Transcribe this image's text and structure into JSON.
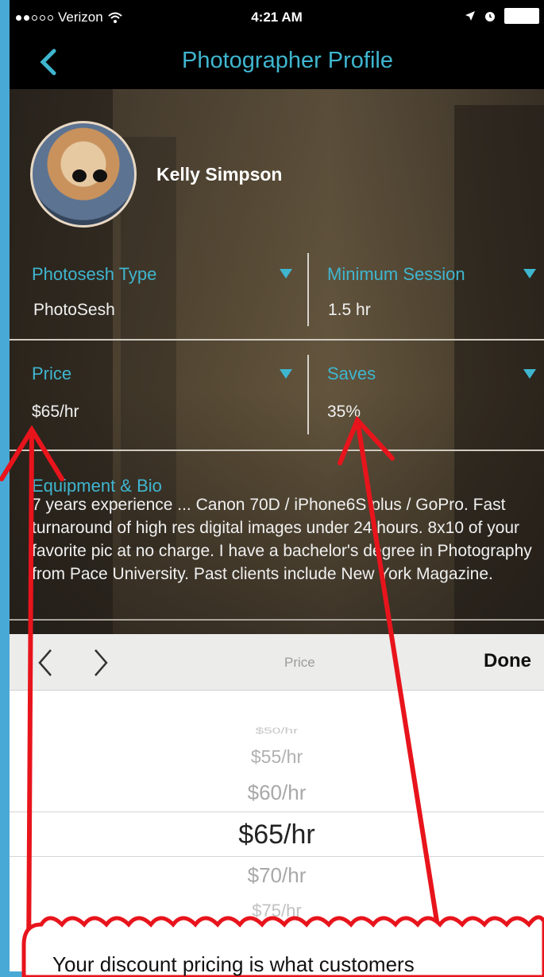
{
  "status_bar": {
    "carrier": "Verizon",
    "time": "4:21 AM",
    "signal_bars_filled": 2,
    "signal_bars_total": 5
  },
  "nav": {
    "title": "Photographer Profile",
    "back_icon": "chevron-left-icon"
  },
  "profile": {
    "name": "Kelly Simpson",
    "fields": {
      "photosesh_type": {
        "label": "Photosesh Type",
        "value": "PhotoSesh"
      },
      "minimum_session": {
        "label": "Minimum Session",
        "value": "1.5 hr"
      },
      "price": {
        "label": "Price",
        "value": "$65/hr"
      },
      "saves": {
        "label": "Saves",
        "value": "35%"
      }
    },
    "bio": {
      "label": "Equipment & Bio",
      "text": "7 years experience ... Canon 70D / iPhone6S plus / GoPro.  Fast turnaround of high res digital images under 24 hours.  8x10 of your favorite pic at no charge. I have a bachelor's degree in Photography from Pace University. Past clients include New York Magazine."
    }
  },
  "picker": {
    "toolbar_title": "Price",
    "done_label": "Done",
    "options": [
      "$50/hr",
      "$55/hr",
      "$60/hr",
      "$65/hr",
      "$70/hr",
      "$75/hr"
    ],
    "selected": "$65/hr"
  },
  "annotation": {
    "text": "Your discount pricing is what customers",
    "color": "#e8141c"
  },
  "colors": {
    "accent": "#3fb6cf",
    "frame": "#49a9d6",
    "annotation": "#e8141c"
  }
}
